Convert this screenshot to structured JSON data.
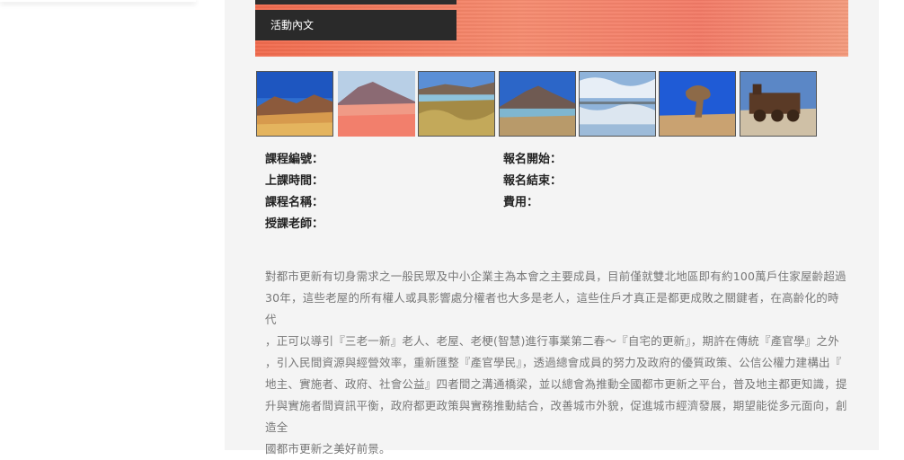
{
  "hero": {
    "caption": "活動內文"
  },
  "gallery": {
    "thumbnails": [
      {
        "name": "desert-mountains",
        "active": false
      },
      {
        "name": "pink-lagoon-mountain",
        "active": true
      },
      {
        "name": "grassland-lake",
        "active": false
      },
      {
        "name": "volcano-lake",
        "active": false
      },
      {
        "name": "salt-flat-reflection",
        "active": false
      },
      {
        "name": "stone-tree",
        "active": false
      },
      {
        "name": "train-cemetery",
        "active": false
      }
    ]
  },
  "course_info": {
    "left": [
      {
        "label": "課程編號："
      },
      {
        "label": "上課時間："
      },
      {
        "label": "課程名稱："
      },
      {
        "label": "授課老師："
      }
    ],
    "right": [
      {
        "label": "報名開始："
      },
      {
        "label": "報名結束："
      },
      {
        "label": "費用："
      }
    ]
  },
  "description": {
    "lines": [
      "對都市更新有切身需求之一般民眾及中小企業主為本會之主要成員，目前僅就雙北地區即有約100萬戶住家屋齡超過",
      "30年，這些老屋的所有權人或具影響處分權者也大多是老人，這些住戶才真正是都更成敗之關鍵者，在高齡化的時代",
      "，正可以導引『三老一新』老人、老屋、老梗(智慧)進行事業第二春〜『自宅的更新』，期許在傳統『產官學』之外",
      "，引入民間資源與經營效率，重新匯整『產官學民』，透過總會成員的努力及政府的優質政策、公信公權力建構出『",
      "地主、實施者、政府、社會公益』四者間之溝通橋梁，並以總會為推動全國都市更新之平台，普及地主都更知識，提",
      "升與實施者間資訊平衡，政府都更政策與實務推動結合，改善城市外貌，促進城市經濟發展，期望能從多元面向，創造全",
      "國都市更新之美好前景。"
    ]
  }
}
